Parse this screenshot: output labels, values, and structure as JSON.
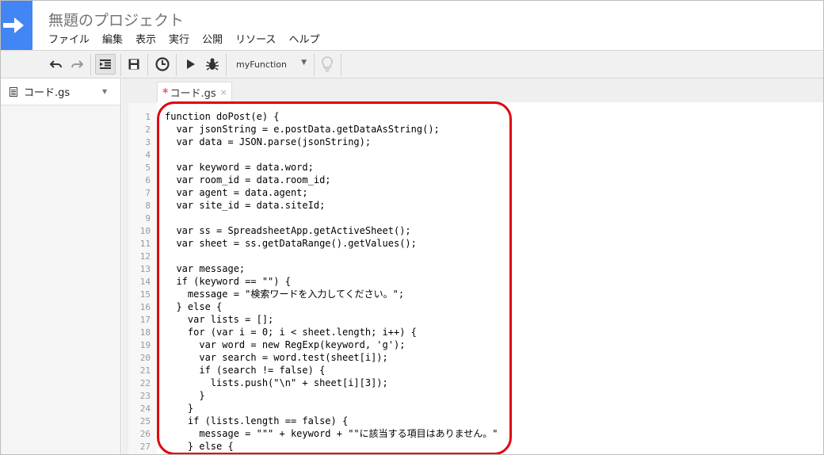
{
  "app": {
    "title": "無題のプロジェクト",
    "brand_color": "#4285f4"
  },
  "menu": {
    "items": [
      "ファイル",
      "編集",
      "表示",
      "実行",
      "公開",
      "リソース",
      "ヘルプ"
    ]
  },
  "toolbar": {
    "undo_icon": "undo-icon",
    "redo_icon": "redo-icon",
    "indent_icon": "indent-icon",
    "save_icon": "save-icon",
    "triggers_icon": "clock-icon",
    "run_icon": "play-icon",
    "debug_icon": "bug-icon",
    "function_select": "myFunction",
    "hint_icon": "lightbulb-icon"
  },
  "sidebar": {
    "file_name": "コード.gs"
  },
  "tab": {
    "modified_marker": "*",
    "label": "コード.gs",
    "close": "×"
  },
  "highlight_color": "#e3000f",
  "editor": {
    "lines": [
      "function doPost(e) {",
      "  var jsonString = e.postData.getDataAsString();",
      "  var data = JSON.parse(jsonString);",
      "",
      "  var keyword = data.word;",
      "  var room_id = data.room_id;",
      "  var agent = data.agent;",
      "  var site_id = data.siteId;",
      "",
      "  var ss = SpreadsheetApp.getActiveSheet();",
      "  var sheet = ss.getDataRange().getValues();",
      "",
      "  var message;",
      "  if (keyword == \"\") {",
      "    message = \"検索ワードを入力してください。\";",
      "  } else {",
      "    var lists = [];",
      "    for (var i = 0; i < sheet.length; i++) {",
      "      var word = new RegExp(keyword, 'g');",
      "      var search = word.test(sheet[i]);",
      "      if (search != false) {",
      "        lists.push(\"\\n\" + sheet[i][3]);",
      "      }",
      "    }",
      "    if (lists.length == false) {",
      "      message = \"\"\" + keyword + \"\"に該当する項目はありません。\"",
      "    } else {"
    ]
  }
}
